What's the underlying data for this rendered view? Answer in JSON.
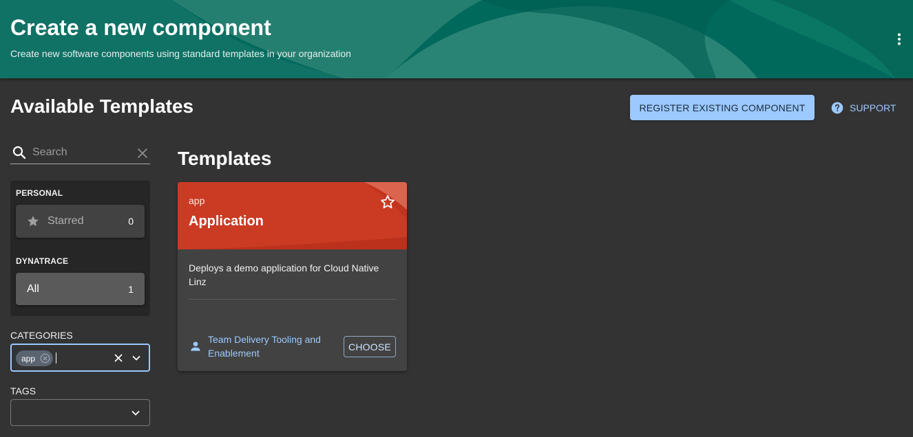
{
  "header": {
    "title": "Create a new component",
    "subtitle": "Create new software components using standard templates in your organization",
    "menu_icon": "more-vert-icon"
  },
  "toolbar": {
    "page_title": "Available Templates",
    "register_label": "REGISTER EXISTING COMPONENT",
    "support_label": "SUPPORT",
    "support_icon": "help-circle-icon"
  },
  "sidebar": {
    "search": {
      "placeholder": "Search",
      "value": ""
    },
    "personal_label": "PERSONAL",
    "starred": {
      "label": "Starred",
      "count": "0",
      "icon": "star-icon"
    },
    "org_label": "DYNATRACE",
    "all": {
      "label": "All",
      "count": "1"
    },
    "categories": {
      "label": "CATEGORIES",
      "chips": [
        "app"
      ]
    },
    "tags": {
      "label": "TAGS",
      "value": ""
    }
  },
  "main": {
    "heading": "Templates",
    "cards": [
      {
        "type": "app",
        "title": "Application",
        "description": "Deploys a demo application for Cloud Native Linz",
        "owner": "Team Delivery Tooling and Enablement",
        "action": "CHOOSE"
      }
    ]
  },
  "colors": {
    "header_bg": "#00695c",
    "page_bg": "#333333",
    "accent": "#9cc9ff",
    "card_header": "#c8351f"
  }
}
